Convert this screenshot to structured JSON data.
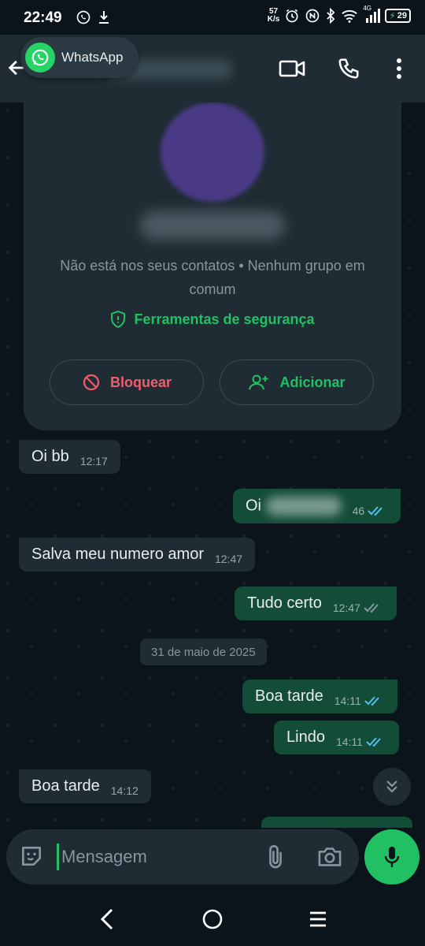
{
  "status": {
    "time": "22:49",
    "netspeed_value": "57",
    "netspeed_unit": "K/s",
    "network": "4G",
    "battery": "29"
  },
  "header": {
    "pip_label": "WhatsApp",
    "icons": [
      "back-arrow-icon",
      "video-call-icon",
      "voice-call-icon",
      "more-vert-icon"
    ]
  },
  "contact_card": {
    "info": "Não está nos seus contatos • Nenhum grupo em comum",
    "safety_tools": "Ferramentas de segurança",
    "block_label": "Bloquear",
    "add_label": "Adicionar"
  },
  "messages": [
    {
      "dir": "in",
      "text": "Oi bb",
      "time": "12:17"
    },
    {
      "dir": "out",
      "text": "Oi",
      "time": "46",
      "status": "read"
    },
    {
      "dir": "in",
      "text": "Salva meu numero amor",
      "time": "12:47"
    },
    {
      "dir": "out",
      "text": "Tudo certo",
      "time": "12:47",
      "status": "delivered"
    },
    {
      "dir": "out",
      "text": "Boa tarde",
      "time": "14:11",
      "status": "read"
    },
    {
      "dir": "out",
      "text": "Lindo",
      "time": "14:11",
      "status": "read"
    },
    {
      "dir": "in",
      "text": "Boa tarde",
      "time": "14:12"
    }
  ],
  "date_divider": "31 de maio de 2025",
  "composer": {
    "placeholder": "Mensagem"
  },
  "colors": {
    "background": "#0b141a",
    "bubble_in": "#1f2c34",
    "bubble_out": "#144d37",
    "accent": "#21c063",
    "danger": "#f15c6d",
    "read_tick": "#53bdeb"
  }
}
